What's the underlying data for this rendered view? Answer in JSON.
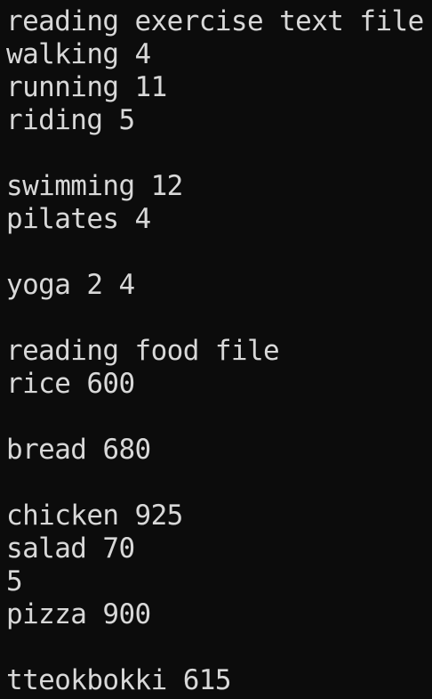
{
  "console": {
    "lines": [
      "reading exercise text file",
      "walking 4",
      "running 11",
      "riding 5",
      "",
      "swimming 12",
      "pilates 4",
      "",
      "yoga 2 4",
      "",
      "reading food file",
      "rice 600",
      "",
      "bread 680",
      "",
      "chicken 925",
      "salad 70",
      "5",
      "pizza 900",
      "",
      "tteokbokki 615"
    ]
  },
  "colors": {
    "background": "#0c0c0c",
    "text": "#d8d8d8"
  }
}
